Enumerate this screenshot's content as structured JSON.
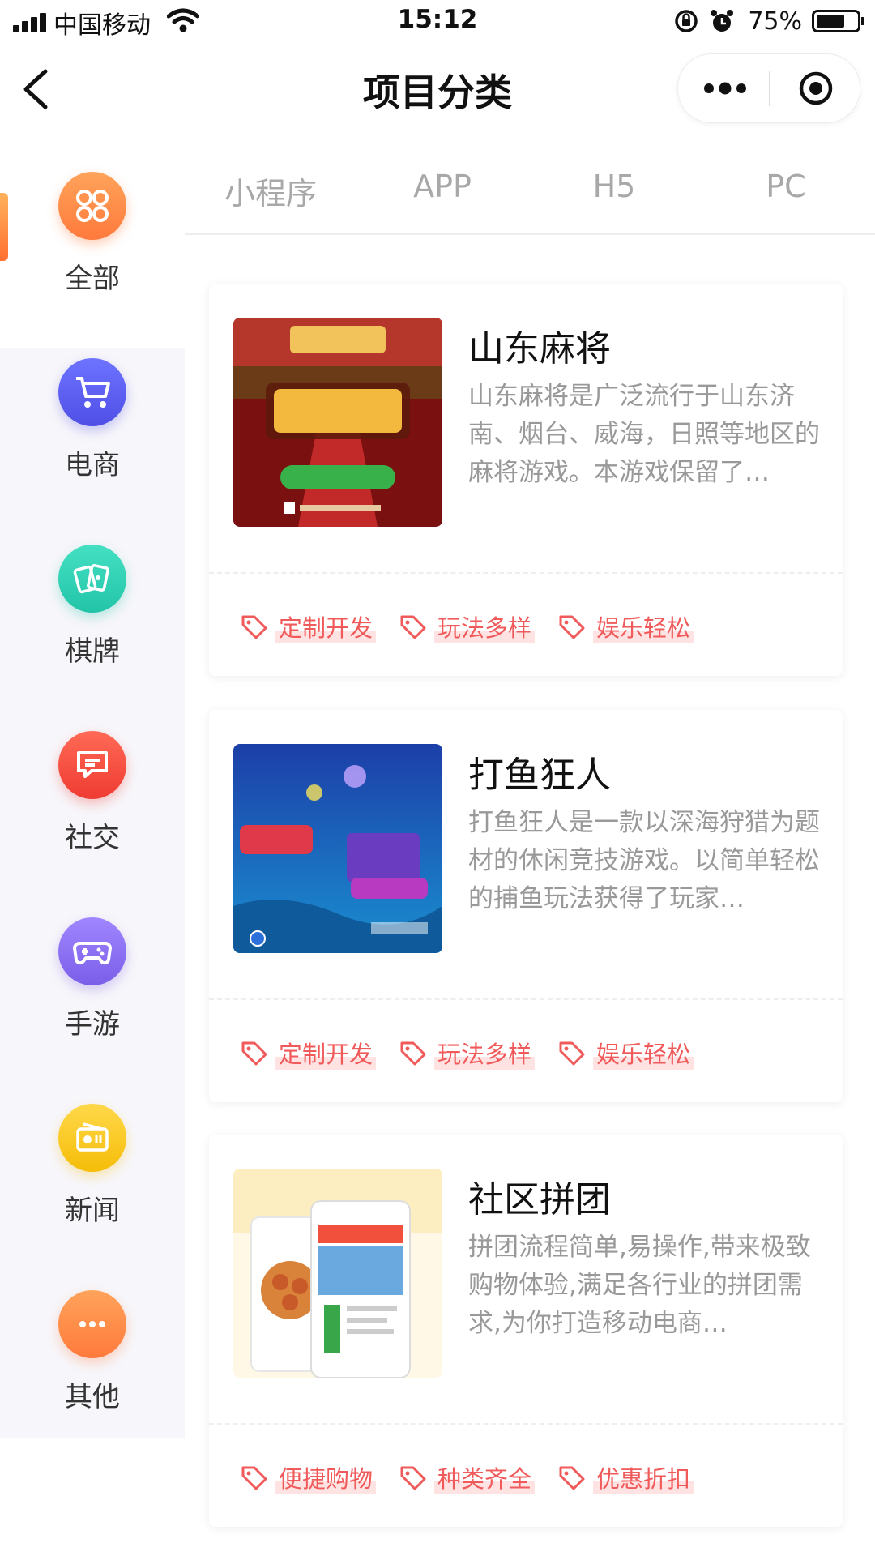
{
  "status_bar": {
    "carrier": "中国移动",
    "time": "15:12",
    "battery": "75%",
    "battery_level": 0.75
  },
  "nav": {
    "title": "项目分类",
    "icons": [
      "back-arrow-icon",
      "more-dots-icon",
      "close-target-icon"
    ]
  },
  "colors": {
    "accent_orange": "#ff7a3c",
    "tag_red": "#f05a5a",
    "sidebar_bg": "#f7f6fa"
  },
  "sidebar": {
    "items": [
      {
        "label": "全部",
        "icon": "grid-icon",
        "color": "#ff8a3d",
        "active": true
      },
      {
        "label": "电商",
        "icon": "cart-icon",
        "color": "#5b5ef5"
      },
      {
        "label": "棋牌",
        "icon": "cards-icon",
        "color": "#2fcfb5"
      },
      {
        "label": "社交",
        "icon": "chat-icon",
        "color": "#f5473c"
      },
      {
        "label": "手游",
        "icon": "gamepad-icon",
        "color": "#8b6bf0"
      },
      {
        "label": "新闻",
        "icon": "radio-icon",
        "color": "#f7c512"
      },
      {
        "label": "其他",
        "icon": "more-icon",
        "color": "#ff8a3d"
      }
    ]
  },
  "tabs": [
    "小程序",
    "APP",
    "H5",
    "PC"
  ],
  "cards": [
    {
      "title": "山东麻将",
      "desc": "山东麻将是广泛流行于山东济南、烟台、威海，日照等地区的麻将游戏。本游戏保留了…",
      "tags": [
        "定制开发",
        "玩法多样",
        "娱乐轻松"
      ]
    },
    {
      "title": "打鱼狂人",
      "desc": "打鱼狂人是一款以深海狩猎为题材的休闲竞技游戏。以简单轻松的捕鱼玩法获得了玩家…",
      "tags": [
        "定制开发",
        "玩法多样",
        "娱乐轻松"
      ]
    },
    {
      "title": "社区拼团",
      "desc": "拼团流程简单,易操作,带来极致购物体验,满足各行业的拼团需求,为你打造移动电商…",
      "tags": [
        "便捷购物",
        "种类齐全",
        "优惠折扣"
      ]
    }
  ]
}
